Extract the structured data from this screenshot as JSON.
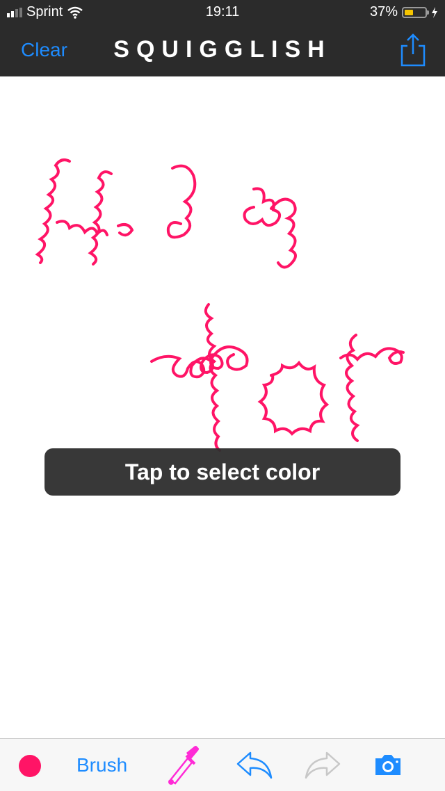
{
  "status_bar": {
    "carrier": "Sprint",
    "time": "19:11",
    "battery_percent": "37%"
  },
  "nav": {
    "clear_label": "Clear",
    "title": "SQUIGGLISH"
  },
  "canvas": {
    "toast": "Tap to select color"
  },
  "toolbar": {
    "brush_label": "Brush",
    "selected_color": "#ff1466"
  },
  "colors": {
    "accent": "#1e8cff",
    "ink": "#ff1466",
    "bar": "#2b2b2b"
  },
  "icons": [
    "share-icon",
    "eyedropper-icon",
    "undo-icon",
    "redo-icon",
    "camera-icon"
  ]
}
